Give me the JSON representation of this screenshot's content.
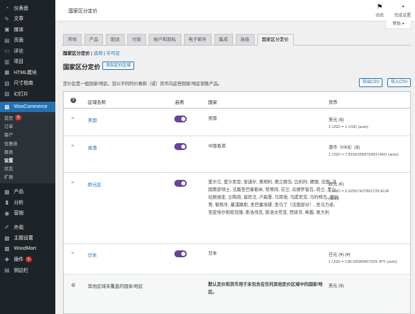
{
  "sidebar": {
    "items": [
      {
        "icon": "dashboard-icon",
        "glyph": "◔",
        "label": "仪表盘"
      },
      {
        "icon": "pin-icon",
        "glyph": "✎",
        "label": "文章"
      },
      {
        "icon": "media-icon",
        "glyph": "▣",
        "label": "媒体"
      },
      {
        "icon": "page-icon",
        "glyph": "▤",
        "label": "页面"
      },
      {
        "icon": "comment-icon",
        "glyph": "▭",
        "label": "评论"
      },
      {
        "icon": "project-icon",
        "glyph": "▥",
        "label": "项目"
      },
      {
        "icon": "html-block-icon",
        "glyph": "▦",
        "label": "HTML模块"
      },
      {
        "icon": "size-guide-icon",
        "glyph": "▧",
        "label": "尺寸指南"
      },
      {
        "icon": "slides-icon",
        "glyph": "▨",
        "label": "幻灯片"
      }
    ],
    "woocommerce": {
      "label": "WooCommerce"
    },
    "sub": [
      {
        "label": "首页",
        "badge": "6"
      },
      {
        "label": "订单"
      },
      {
        "label": "客户"
      },
      {
        "label": "优惠券"
      },
      {
        "label": "报表"
      },
      {
        "label": "设置"
      },
      {
        "label": "状态"
      },
      {
        "label": "扩展"
      }
    ],
    "items2": [
      {
        "icon": "product-icon",
        "glyph": "▩",
        "label": "产品"
      },
      {
        "icon": "analytics-icon",
        "glyph": "▮",
        "label": "分析"
      },
      {
        "icon": "marketing-icon",
        "glyph": "◉",
        "label": "营销"
      }
    ],
    "items3": [
      {
        "icon": "appearance-icon",
        "glyph": "✐",
        "label": "外观"
      },
      {
        "icon": "theme-settings-icon",
        "glyph": "▩",
        "label": "主题设置"
      },
      {
        "icon": "woodmart-icon",
        "glyph": "▩",
        "label": "WoodMart"
      },
      {
        "icon": "plugin-icon",
        "glyph": "✚",
        "label": "插件",
        "badge": "1"
      },
      {
        "icon": "sidebar-icon",
        "glyph": "▤",
        "label": "侧边栏"
      }
    ]
  },
  "header": {
    "title": "国家区分定价",
    "activity": "动态",
    "finish_setup": "完成设置",
    "help": "帮助 ▾"
  },
  "tabs": [
    "常规",
    "产品",
    "配送",
    "付款",
    "帐户和隐私",
    "电子邮件",
    "集成",
    "高级",
    "国家区分定价"
  ],
  "subsub": {
    "current": "国家区分定价",
    "sep1": " | ",
    "options": "选项",
    "sep2": " | ",
    "license": "许可证"
  },
  "page": {
    "heading": "国家区分定价",
    "add_button": "添加定价区域",
    "description": "定价区是一组国家/地区。您以不同的价格和（或）货币向这些国家/地区销售产品。",
    "export_csv": "导出CSV",
    "import_csv": "导入CSV"
  },
  "table": {
    "headers": {
      "help": "?",
      "zone": "区域名称",
      "enabled": "启用",
      "countries": "国家",
      "currency": "货币"
    },
    "rows": [
      {
        "name": "美国",
        "regions": "美国",
        "currency": "美元 ($)",
        "rate": "1 USD = 1 USD (auto)"
      },
      {
        "name": "香港",
        "regions": "中国香港",
        "currency": "港币（HK$）($)",
        "rate": "1 USD = 7.8156356876993 HKD (auto)"
      },
      {
        "name": "欧元区",
        "regions": "爱尔兰, 爱沙尼亚, 安道尔, 奥地利, 奥兰群岛, 比利时, 德国, 法国, 法国南部领土, 法属圣巴泰勒米, 梵蒂冈, 芬兰, 瓜德罗普岛, 荷兰, 黑山, 拉脱维亚, 立陶宛, 留尼汪, 卢森堡, 马耳他, 马提尼克, 马约特岛, 摩纳哥, 葡萄牙, 塞浦路斯, 圣巴塞洛缪, 圣马丁（法国部分）, 圣马力诺, 圣皮埃尔和密克隆, 斯洛伐克, 斯洛文尼亚, 西班牙, 希腊, 意大利",
        "currency": "欧元 (€)",
        "rate": "1 USD = 0.92557437861729 EUR (auto)"
      },
      {
        "name": "日本",
        "regions": "日本",
        "currency": "日元 (¥) (¥)",
        "rate": "1 USD = 138.03089407029 JPY (auto)"
      }
    ],
    "last": {
      "name": "其他区域未覆盖的国家/地区",
      "regions": "默认定价和货币用于未包含在任何其他定价区域中的国家/地区。",
      "currency": "美元 ($)"
    }
  }
}
